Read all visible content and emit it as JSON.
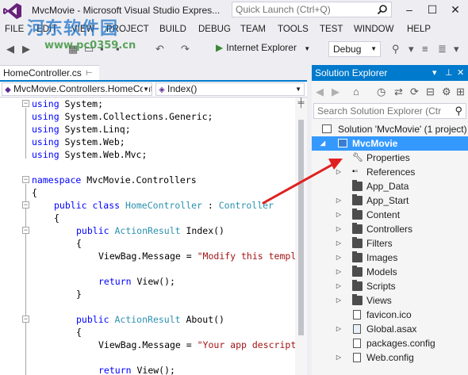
{
  "window": {
    "title": "MvcMovie - Microsoft Visual Studio Expres...",
    "quick_launch_placeholder": "Quick Launch (Ctrl+Q)"
  },
  "watermark": {
    "text": "河东软件园",
    "url": "www.pc0359.cn"
  },
  "menu": [
    "FILE",
    "EDIT",
    "VIEW",
    "PROJECT",
    "BUILD",
    "DEBUG",
    "TEAM",
    "TOOLS",
    "TEST",
    "WINDOW",
    "HELP"
  ],
  "toolbar": {
    "run_label": "Internet Explorer",
    "configuration": "Debug"
  },
  "editor": {
    "tab_title": "HomeController.cs",
    "nav_class": "MvcMovie.Controllers.HomeCont",
    "nav_member": "Index()"
  },
  "code": [
    {
      "kw": "using",
      "rest": " System;"
    },
    {
      "kw": "using",
      "rest": " System.Collections.Generic;"
    },
    {
      "kw": "using",
      "rest": " System.Linq;"
    },
    {
      "kw": "using",
      "rest": " System.Web;"
    },
    {
      "kw": "using",
      "rest": " System.Web.Mvc;"
    },
    {
      "kw": "namespace",
      "rest": " MvcMovie.Controllers"
    },
    {
      "plain": "{"
    },
    {
      "kw": "public class",
      "type": "HomeController",
      "sep": " : ",
      "type2": "Controller"
    },
    {
      "plain": "{"
    },
    {
      "kw": "public",
      "type": "ActionResult",
      "rest": " Index()"
    },
    {
      "plain": "{"
    },
    {
      "pre": "ViewBag.Message = ",
      "str": "\"Modify this templ"
    },
    {
      "kw": "return",
      "rest": " View();"
    },
    {
      "plain": "}"
    },
    {
      "kw": "public",
      "type": "ActionResult",
      "rest": " About()"
    },
    {
      "plain": "{"
    },
    {
      "pre": "ViewBag.Message = ",
      "str": "\"Your app descript"
    },
    {
      "kw": "return",
      "rest": " View();"
    }
  ],
  "solution_explorer": {
    "title": "Solution Explorer",
    "search_placeholder": "Search Solution Explorer (Ctrl+;)",
    "items": [
      {
        "label": "Solution 'MvcMovie' (1 project)",
        "icon": "solution-icon",
        "expander": "none"
      },
      {
        "label": "MvcMovie",
        "icon": "web-project-icon",
        "expander": "expanded",
        "selected": true
      },
      {
        "label": "Properties",
        "icon": "wrench-icon",
        "expander": "none"
      },
      {
        "label": "References",
        "icon": "references-icon",
        "expander": "collapsed"
      },
      {
        "label": "App_Data",
        "icon": "folder-icon",
        "expander": "none"
      },
      {
        "label": "App_Start",
        "icon": "folder-icon",
        "expander": "collapsed"
      },
      {
        "label": "Content",
        "icon": "folder-icon",
        "expander": "collapsed"
      },
      {
        "label": "Controllers",
        "icon": "folder-icon",
        "expander": "collapsed"
      },
      {
        "label": "Filters",
        "icon": "folder-icon",
        "expander": "collapsed"
      },
      {
        "label": "Images",
        "icon": "folder-icon",
        "expander": "collapsed"
      },
      {
        "label": "Models",
        "icon": "folder-icon",
        "expander": "collapsed"
      },
      {
        "label": "Scripts",
        "icon": "folder-icon",
        "expander": "collapsed"
      },
      {
        "label": "Views",
        "icon": "folder-icon",
        "expander": "collapsed"
      },
      {
        "label": "favicon.ico",
        "icon": "image-file-icon",
        "expander": "none"
      },
      {
        "label": "Global.asax",
        "icon": "asax-file-icon",
        "expander": "collapsed"
      },
      {
        "label": "packages.config",
        "icon": "config-file-icon",
        "expander": "none"
      },
      {
        "label": "Web.config",
        "icon": "config-file-icon",
        "expander": "collapsed"
      }
    ]
  },
  "colors": {
    "accent": "#007acc",
    "selection": "#3399ff",
    "keyword": "#0000ff",
    "type": "#2b91af",
    "string": "#a31515",
    "annotation_arrow": "#e02020"
  }
}
